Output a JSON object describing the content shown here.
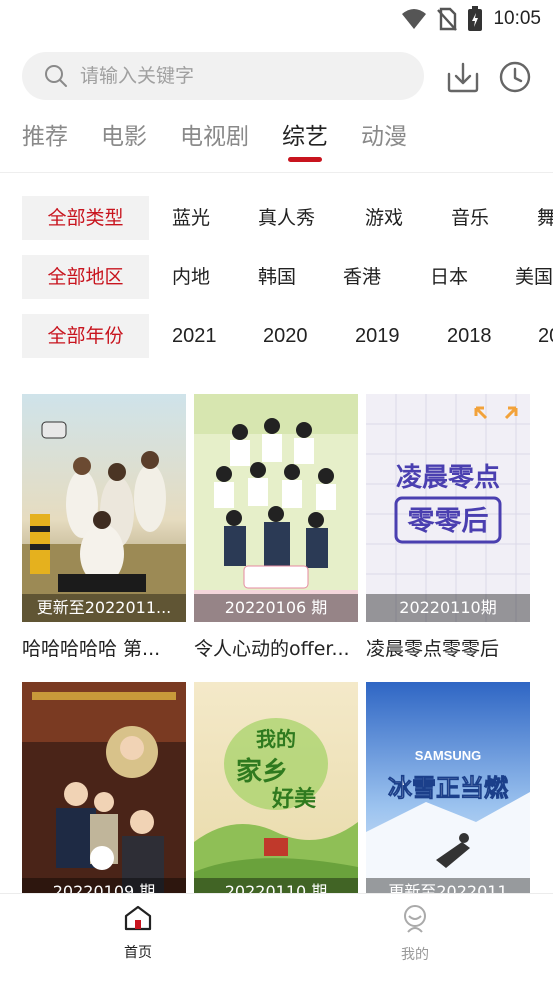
{
  "status_bar": {
    "time": "10:05"
  },
  "search": {
    "placeholder": "请输入关键字"
  },
  "tabs": [
    {
      "label": "推荐",
      "active": false
    },
    {
      "label": "电影",
      "active": false
    },
    {
      "label": "电视剧",
      "active": false
    },
    {
      "label": "综艺",
      "active": true
    },
    {
      "label": "动漫",
      "active": false
    }
  ],
  "filters": {
    "genre": {
      "selected": "全部类型",
      "options": [
        "蓝光",
        "真人秀",
        "游戏",
        "音乐",
        "舞"
      ]
    },
    "region": {
      "selected": "全部地区",
      "options": [
        "内地",
        "韩国",
        "香港",
        "日本",
        "美国"
      ]
    },
    "year": {
      "selected": "全部年份",
      "options": [
        "2021",
        "2020",
        "2019",
        "2018",
        "20"
      ]
    }
  },
  "cards": [
    {
      "title": "哈哈哈哈哈 第...",
      "caption": "更新至2022011..."
    },
    {
      "title": "令人心动的offer...",
      "caption": "20220106 期"
    },
    {
      "title": "凌晨零点零零后",
      "caption": "20220110期",
      "poster_text": [
        "凌晨零点",
        "零零后"
      ]
    },
    {
      "title": "",
      "caption": "20220109 期"
    },
    {
      "title": "",
      "caption": "20220110 期",
      "poster_text": [
        "我的",
        "家乡",
        "好美"
      ]
    },
    {
      "title": "",
      "caption": "更新至2022011",
      "poster_text": [
        "SAMSUNG",
        "冰雪正当燃"
      ]
    }
  ],
  "bottom_nav": {
    "home": "首页",
    "mine": "我的"
  },
  "colors": {
    "accent": "#c8141e",
    "inactive_tab": "#8a8a8a",
    "filter_bg": "#f2f2f2"
  }
}
